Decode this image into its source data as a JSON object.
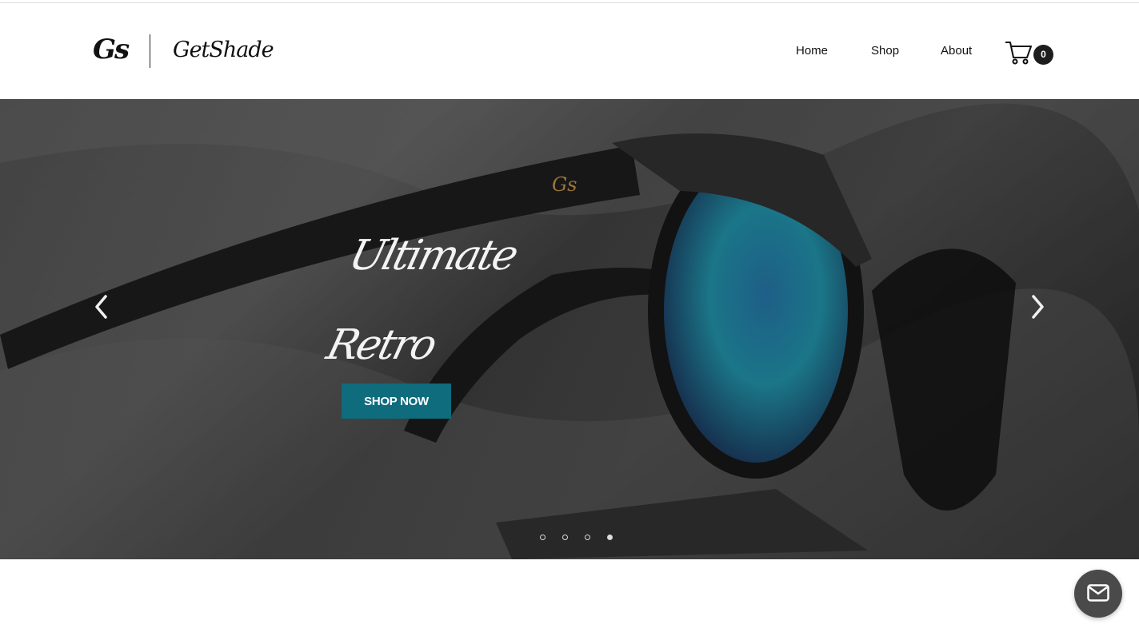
{
  "brand": {
    "monogram": "Gs",
    "wordmark": "GetShade"
  },
  "nav": {
    "items": [
      {
        "label": "Home"
      },
      {
        "label": "Shop"
      },
      {
        "label": "About"
      }
    ],
    "cart_count": "0",
    "cart_icon": "shopping-cart-icon"
  },
  "hero": {
    "headline_line_1": "Ultimate",
    "headline_line_2": "Retro",
    "cta_label": "SHOP NOW",
    "slides_total": 4,
    "active_slide": 4,
    "prev_icon": "chevron-left-icon",
    "next_icon": "chevron-right-icon",
    "cta_color": "#0e6c7d"
  },
  "chat": {
    "icon": "mail-icon"
  }
}
